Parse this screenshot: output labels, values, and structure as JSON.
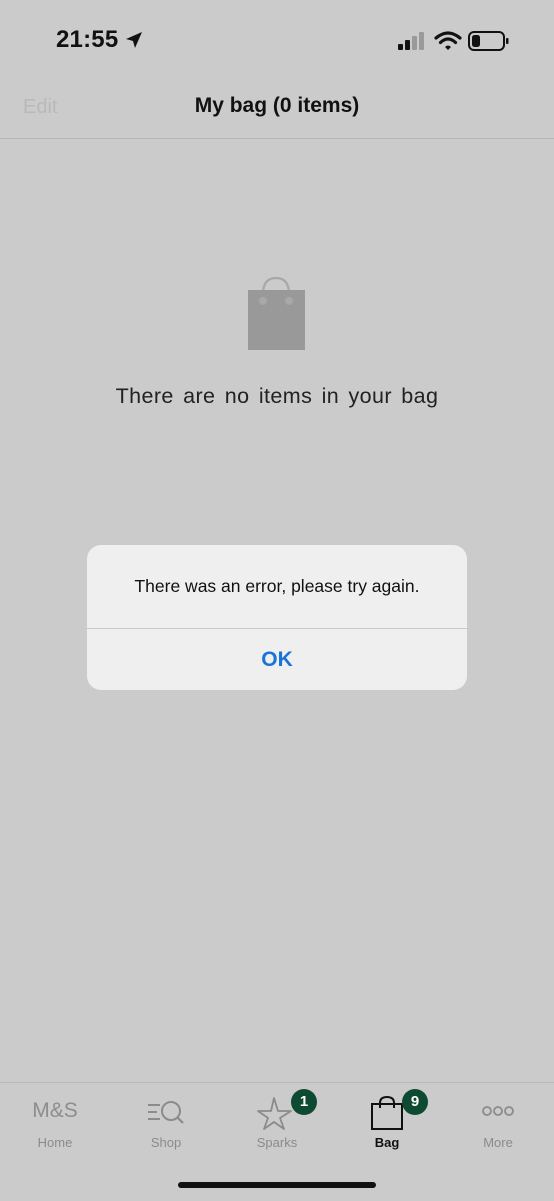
{
  "status_bar": {
    "time": "21:55"
  },
  "nav": {
    "edit_label": "Edit",
    "title": "My bag (0 items)"
  },
  "empty_state": {
    "message": "There are no items in your bag"
  },
  "alert": {
    "message": "There was an error, please try again.",
    "ok_label": "OK"
  },
  "tab_bar": {
    "tabs": [
      {
        "label": "Home",
        "icon": "ms-logo-icon",
        "logo_text": "M&S",
        "active": false
      },
      {
        "label": "Shop",
        "icon": "search-menu-icon",
        "active": false
      },
      {
        "label": "Sparks",
        "icon": "star-icon",
        "badge": "1",
        "active": false
      },
      {
        "label": "Bag",
        "icon": "bag-icon",
        "badge": "9",
        "active": true
      },
      {
        "label": "More",
        "icon": "more-dots-icon",
        "active": false
      }
    ]
  },
  "colors": {
    "accent": "#1a73d9",
    "badge": "#0e4a31",
    "background": "#cbcbcb"
  }
}
